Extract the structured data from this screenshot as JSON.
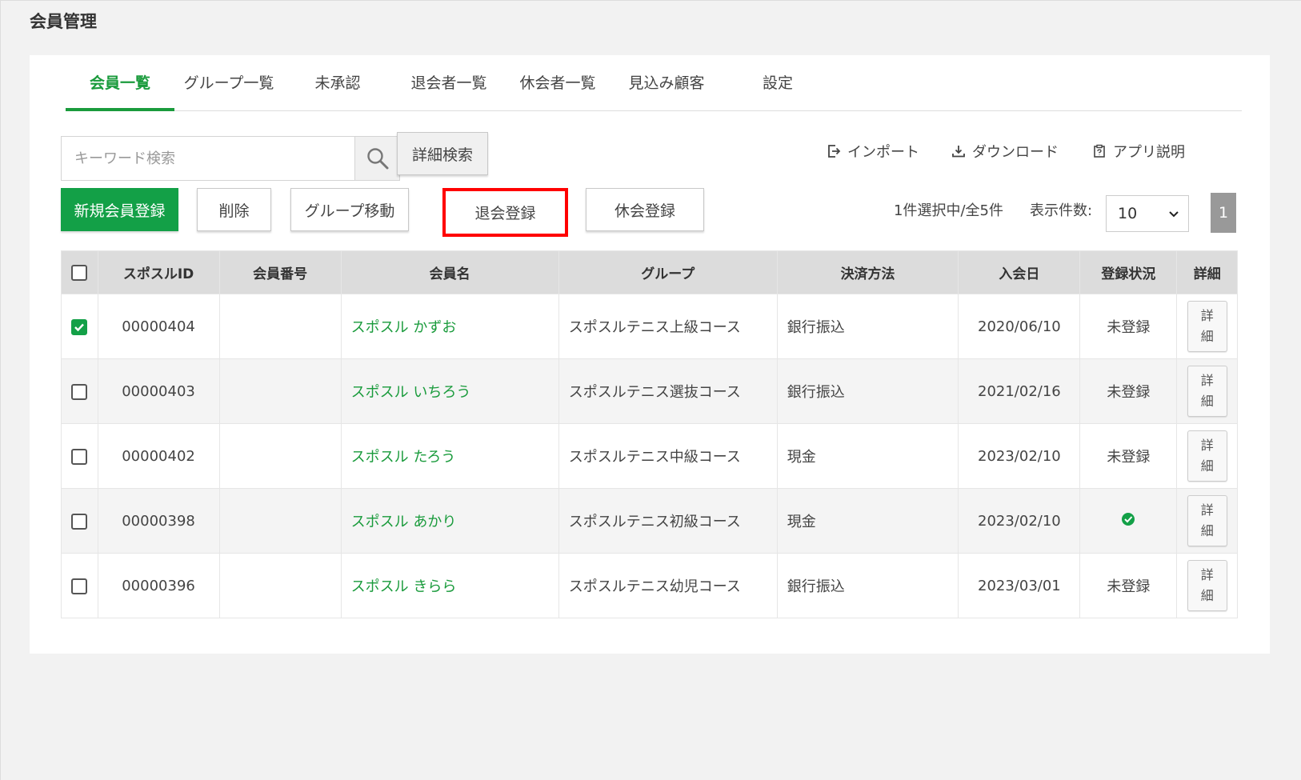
{
  "page": {
    "title": "会員管理"
  },
  "tabs": [
    {
      "label": "会員一覧",
      "active": true
    },
    {
      "label": "グループ一覧"
    },
    {
      "label": "未承認"
    },
    {
      "label": "退会者一覧"
    },
    {
      "label": "休会者一覧"
    },
    {
      "label": "見込み顧客"
    },
    {
      "label": "設定"
    }
  ],
  "search": {
    "placeholder": "キーワード検索",
    "detail_label": "詳細検索"
  },
  "links": {
    "import": "インポート",
    "download": "ダウンロード",
    "app_help": "アプリ説明"
  },
  "actions": {
    "new_member": "新規会員登録",
    "delete": "削除",
    "move_group": "グループ移動",
    "withdraw": "退会登録",
    "suspend": "休会登録"
  },
  "selection": {
    "info": "1件選択中/全5件",
    "per_page_label": "表示件数:",
    "per_page_value": "10",
    "page": "1"
  },
  "table": {
    "headers": [
      "スポスルID",
      "会員番号",
      "会員名",
      "グループ",
      "決済方法",
      "入会日",
      "登録状況",
      "詳細"
    ],
    "detail_label": [
      "詳",
      "細"
    ],
    "rows": [
      {
        "id": "00000404",
        "number": "",
        "name": "スポスル かずお",
        "group": "スポスルテニス上級コース",
        "payment": "銀行振込",
        "joined": "2020/06/10",
        "status": "未登録",
        "checked": true
      },
      {
        "id": "00000403",
        "number": "",
        "name": "スポスル いちろう",
        "group": "スポスルテニス選抜コース",
        "payment": "銀行振込",
        "joined": "2021/02/16",
        "status": "未登録",
        "checked": false
      },
      {
        "id": "00000402",
        "number": "",
        "name": "スポスル たろう",
        "group": "スポスルテニス中級コース",
        "payment": "現金",
        "joined": "2023/02/10",
        "status": "未登録",
        "checked": false
      },
      {
        "id": "00000398",
        "number": "",
        "name": "スポスル あかり",
        "group": "スポスルテニス初級コース",
        "payment": "現金",
        "joined": "2023/02/10",
        "status": "",
        "status_icon": "check-circle-icon",
        "checked": false
      },
      {
        "id": "00000396",
        "number": "",
        "name": "スポスル きらら",
        "group": "スポスルテニス幼児コース",
        "payment": "銀行振込",
        "joined": "2023/03/01",
        "status": "未登録",
        "checked": false
      }
    ]
  },
  "colors": {
    "accent": "#13a047",
    "highlight": "#ff0000"
  }
}
